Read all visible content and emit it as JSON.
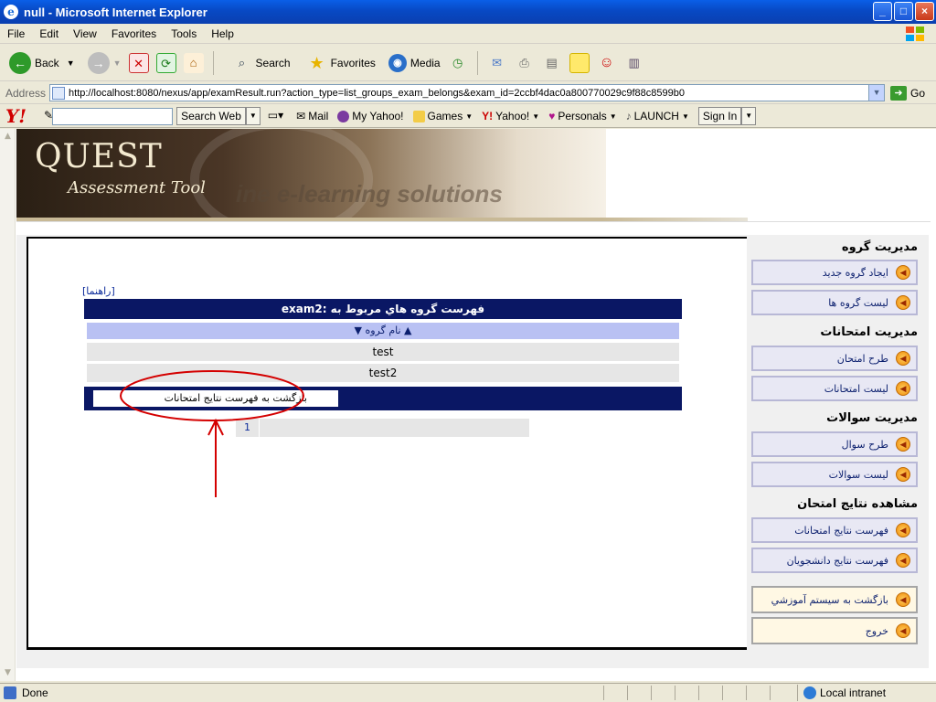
{
  "window": {
    "title": "null - Microsoft Internet Explorer",
    "minimize": "_",
    "maximize": "□",
    "close": "×"
  },
  "menu": [
    "File",
    "Edit",
    "View",
    "Favorites",
    "Tools",
    "Help"
  ],
  "toolbar": {
    "back": "Back",
    "search": "Search",
    "favorites": "Favorites",
    "media": "Media"
  },
  "address": {
    "label": "Address",
    "url": "http://localhost:8080/nexus/app/examResult.run?action_type=list_groups_exam_belongs&exam_id=2ccbf4dac0a800770029c9f88c8599b0",
    "go": "Go"
  },
  "yahoo": {
    "logo": "Y!",
    "search_button": "Search Web",
    "mail": "Mail",
    "my_yahoo": "My Yahoo!",
    "games": "Games",
    "yahoo": "Yahoo!",
    "personals": "Personals",
    "launch": "LAUNCH",
    "sign_in": "Sign In"
  },
  "banner": {
    "title": "QUEST",
    "subtitle": "Assessment Tool",
    "tagline": "ine e-learning solutions"
  },
  "main": {
    "help_link": "[راهنما]",
    "table_title": "فهرست گروه هاي مربوط به :exam2",
    "column_header": "نام گروه",
    "rows": [
      "test",
      "test2"
    ],
    "back_button": "بازگشت به فهرست نتايج امتحانات",
    "page_number": "1"
  },
  "sidebar": {
    "sections": [
      {
        "title": "مديريت گروه",
        "items": [
          "ايجاد گروه جديد",
          "ليست گروه ها"
        ]
      },
      {
        "title": "مديريت امتحانات",
        "items": [
          "طرح امتحان",
          "ليست امتحانات"
        ]
      },
      {
        "title": "مديريت سوالات",
        "items": [
          "طرح سوال",
          "ليست سوالات"
        ]
      },
      {
        "title": "مشاهده نتايج امتحان",
        "items": [
          "فهرست نتايج امتحانات",
          "فهرست نتايج دانشجويان"
        ]
      }
    ],
    "bottom": [
      "بازگشت به سيستم آموزشي",
      "خروج"
    ]
  },
  "status": {
    "text": "Done",
    "zone": "Local intranet"
  },
  "colors": {
    "title_blue": "#0a49c4",
    "table_navy": "#0a1764",
    "column_header": "#b9c1f3",
    "annotation_red": "#d40000"
  }
}
